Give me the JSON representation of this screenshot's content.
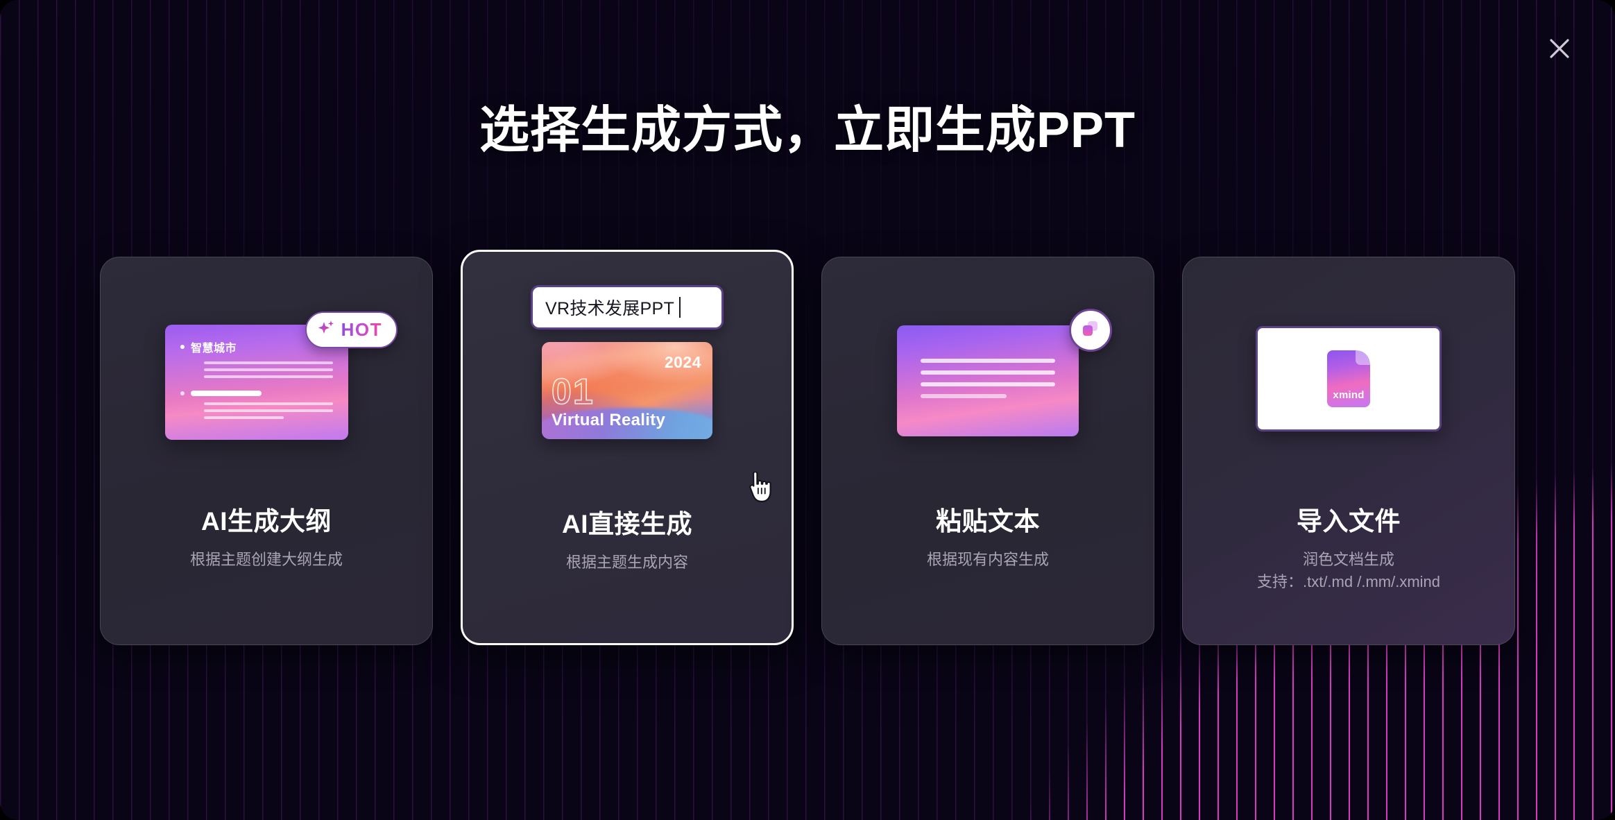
{
  "header": {
    "title": "选择生成方式，立即生成PPT",
    "close_icon": "close-x-icon"
  },
  "cards": [
    {
      "id": "ai-outline",
      "title": "AI生成大纲",
      "subtitle": "根据主题创建大纲生成",
      "subtitle2": "",
      "selected": false,
      "badge": {
        "label": "HOT",
        "icon": "sparkle-icon"
      },
      "art": {
        "kind": "outline-mock",
        "heading": "智慧城市"
      }
    },
    {
      "id": "ai-direct",
      "title": "AI直接生成",
      "subtitle": "根据主题生成内容",
      "subtitle2": "",
      "selected": true,
      "art": {
        "kind": "prompt-and-slide",
        "input_value": "VR技术发展PPT",
        "slide_year": "2024",
        "slide_number": "01",
        "slide_label": "Virtual Reality"
      }
    },
    {
      "id": "paste-text",
      "title": "粘贴文本",
      "subtitle": "根据现有内容生成",
      "subtitle2": "",
      "selected": false,
      "badge": {
        "label": "",
        "icon": "copy-icon"
      },
      "art": {
        "kind": "text-mock"
      }
    },
    {
      "id": "import-file",
      "title": "导入文件",
      "subtitle": "润色文档生成",
      "subtitle2": "支持：.txt/.md /.mm/.xmind",
      "selected": false,
      "art": {
        "kind": "file-mock",
        "file_label": "xmind"
      }
    }
  ],
  "cursor": {
    "icon": "hand-pointer-cursor"
  },
  "colors": {
    "background": "#090516",
    "line_dim": "#963cbe",
    "line_bright": "#e23cc8",
    "card_bg": "#2b2736",
    "selected_border": "#ffffff",
    "accent_purple": "#8b4ae8",
    "accent_pink": "#f0469c",
    "text_primary": "#ffffff",
    "text_secondary": "#a9a5b5"
  }
}
